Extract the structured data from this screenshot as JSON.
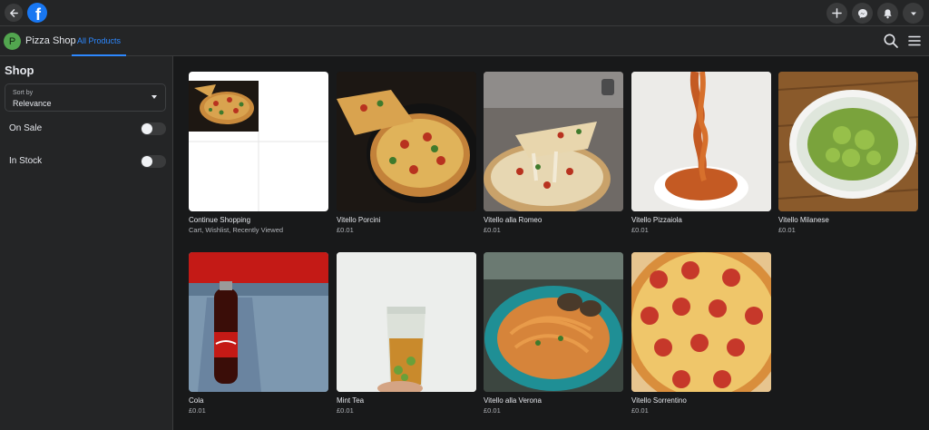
{
  "topbar": {
    "back_icon": "arrow-left-icon",
    "logo_letter": "f",
    "actions": [
      "plus-icon",
      "messenger-icon",
      "bell-icon",
      "caret-down-icon"
    ]
  },
  "shopbar": {
    "avatar_letter": "P",
    "shop_name": "Pizza Shop",
    "tab_label": "All Products"
  },
  "sidebar": {
    "title": "Shop",
    "sort_caption": "Sort by",
    "sort_value": "Relevance",
    "filters": [
      {
        "label": "On Sale",
        "enabled": false
      },
      {
        "label": "In Stock",
        "enabled": false
      }
    ]
  },
  "products": [
    {
      "title": "Continue Shopping",
      "subtitle": "Cart, Wishlist, Recently Viewed"
    },
    {
      "title": "Vitello Porcini",
      "subtitle": "£0.01"
    },
    {
      "title": "Vitello alla Romeo",
      "subtitle": "£0.01"
    },
    {
      "title": "Vitello Pizzaiola",
      "subtitle": "£0.01"
    },
    {
      "title": "Vitello Milanese",
      "subtitle": "£0.01"
    },
    {
      "title": "Cola",
      "subtitle": "£0.01"
    },
    {
      "title": "Mint Tea",
      "subtitle": "£0.01"
    },
    {
      "title": "Vitello alla Verona",
      "subtitle": "£0.01"
    },
    {
      "title": "Vitello Sorrentino",
      "subtitle": "£0.01"
    }
  ],
  "colors": {
    "accent": "#2d88ff",
    "surface": "#242526",
    "background": "#18191a"
  }
}
